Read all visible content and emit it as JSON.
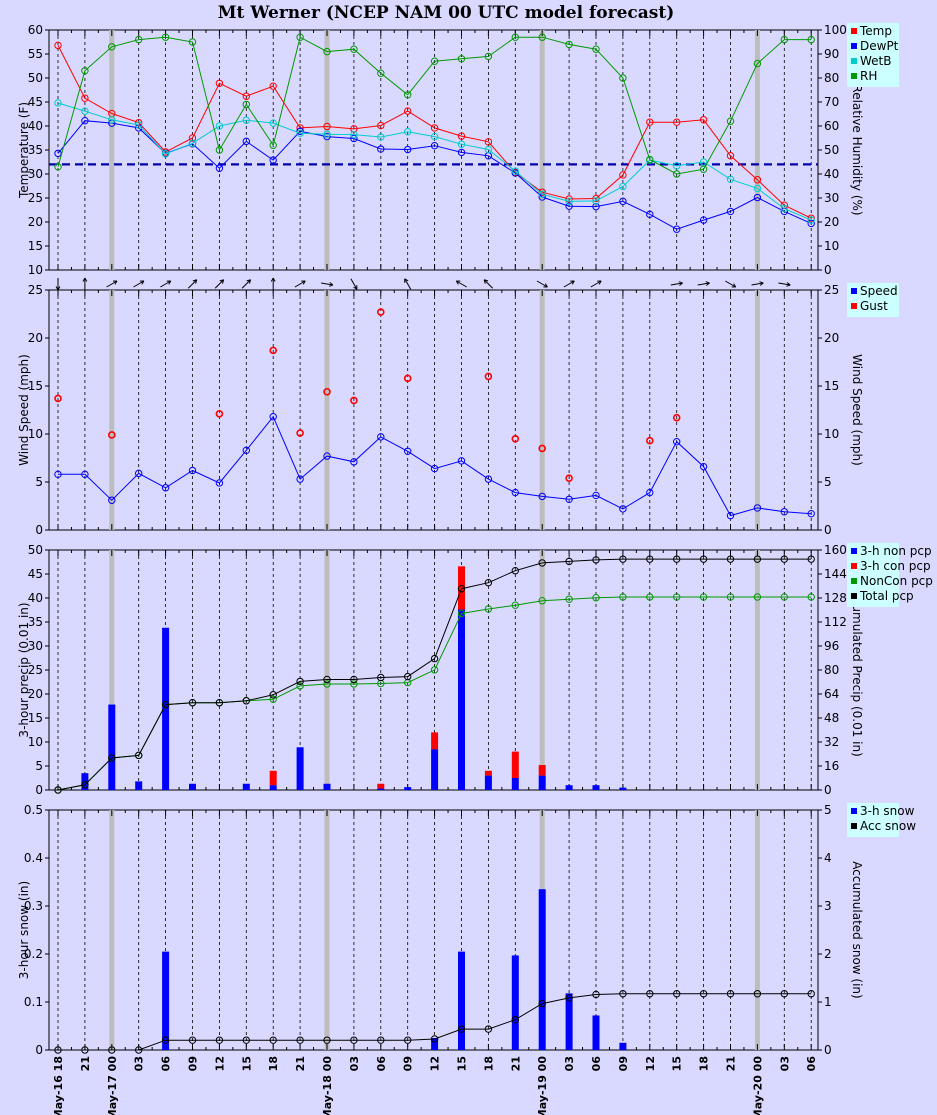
{
  "title": "Mt Werner (NCEP NAM 00 UTC model forecast)",
  "x_tick_labels": [
    "May-16 18",
    "21",
    "May-17 00",
    "03",
    "06",
    "09",
    "12",
    "15",
    "18",
    "21",
    "May-18 00",
    "03",
    "06",
    "09",
    "12",
    "15",
    "18",
    "21",
    "May-19 00",
    "03",
    "06",
    "09",
    "12",
    "15",
    "18",
    "21",
    "May-20 00",
    "03",
    "06"
  ],
  "colors": {
    "temp": "#ff0000",
    "dewpt": "#0000ff",
    "wetb": "#00cccc",
    "rh": "#009900",
    "gust": "#ff0000",
    "total": "#000000",
    "freezing": "#0000aa",
    "bg": "#d9d9ff",
    "grid_day": "#bdbdbd"
  },
  "chart_data": [
    {
      "type": "line",
      "panel": "temperature",
      "ylabel": "Temperature (F)",
      "y2label": "Relative Humidity (%)",
      "ylim": [
        10,
        60
      ],
      "y2lim": [
        0,
        100
      ],
      "yticks": [
        10,
        15,
        20,
        25,
        30,
        35,
        40,
        45,
        50,
        55,
        60
      ],
      "y2ticks": [
        0,
        10,
        20,
        30,
        40,
        50,
        60,
        70,
        80,
        90,
        100
      ],
      "freezing_line": 32,
      "legend": [
        "Temp",
        "DewPt",
        "WetB",
        "RH"
      ],
      "legend_position": "right",
      "series": [
        {
          "name": "Temp",
          "axis": "left",
          "values": [
            56.8,
            45.8,
            42.6,
            40.7,
            34.6,
            37.5,
            48.9,
            46.2,
            48.3,
            39.6,
            39.9,
            39.4,
            40.1,
            43.1,
            39.6,
            37.9,
            36.7,
            30.3,
            26.2,
            24.8,
            24.9,
            29.8,
            40.8,
            40.8,
            41.3,
            33.8,
            28.8,
            23.5,
            20.8
          ]
        },
        {
          "name": "DewPt",
          "axis": "left",
          "values": [
            34.3,
            41.1,
            40.6,
            39.6,
            34.3,
            36.3,
            31.2,
            36.8,
            32.9,
            38.9,
            37.8,
            37.4,
            35.2,
            35.1,
            35.9,
            34.5,
            33.8,
            30.2,
            25.2,
            23.3,
            23.2,
            24.3,
            21.6,
            18.5,
            20.4,
            22.2,
            25.1,
            22.2,
            19.7
          ]
        },
        {
          "name": "WetB",
          "axis": "left",
          "values": [
            44.8,
            43.1,
            41.3,
            40.2,
            34.2,
            36.4,
            40.0,
            41.2,
            40.6,
            38.5,
            38.3,
            38.2,
            37.7,
            38.8,
            37.8,
            36.2,
            35.1,
            30.6,
            25.8,
            24.3,
            24.4,
            27.4,
            32.9,
            31.7,
            32.5,
            28.9,
            27.0,
            22.8,
            20.4
          ]
        },
        {
          "name": "RH",
          "axis": "right",
          "values": [
            43,
            83,
            93,
            96,
            97,
            95,
            50,
            69,
            52,
            97,
            91,
            92,
            82,
            73,
            87,
            88,
            89,
            97,
            97,
            94,
            92,
            80,
            46,
            40,
            42,
            62,
            86,
            96,
            96
          ]
        }
      ]
    },
    {
      "type": "line",
      "panel": "wind",
      "ylabel": "Wind Speed (mph)",
      "y2label": "Wind Speed (mph)",
      "ylim": [
        0,
        25
      ],
      "yticks": [
        0,
        5,
        10,
        15,
        20,
        25
      ],
      "legend": [
        "Speed",
        "Gust"
      ],
      "legend_position": "right",
      "series": [
        {
          "name": "Speed",
          "values": [
            5.8,
            5.8,
            3.1,
            5.9,
            4.4,
            6.2,
            4.9,
            8.3,
            11.8,
            5.3,
            7.7,
            7.1,
            9.7,
            8.2,
            6.4,
            7.2,
            5.3,
            3.9,
            3.5,
            3.2,
            3.6,
            2.2,
            3.9,
            9.2,
            6.6,
            1.5,
            2.3,
            1.9,
            1.7
          ]
        },
        {
          "name": "Gust",
          "values": [
            13.7,
            null,
            9.9,
            null,
            null,
            null,
            12.1,
            null,
            18.7,
            10.1,
            14.4,
            13.5,
            22.7,
            15.8,
            null,
            null,
            16.0,
            9.5,
            8.5,
            5.4,
            null,
            null,
            9.3,
            11.7,
            null,
            null,
            null,
            null,
            null
          ]
        }
      ],
      "wind_direction_deg": [
        180,
        0,
        60,
        60,
        60,
        45,
        45,
        45,
        0,
        60,
        100,
        150,
        null,
        330,
        null,
        300,
        315,
        null,
        120,
        60,
        60,
        null,
        null,
        80,
        80,
        120,
        80,
        100,
        null
      ]
    },
    {
      "type": "bar",
      "panel": "precip",
      "ylabel": "3-hour precip (0.01 in)",
      "y2label": "Accumulated Precip (0.01 in)",
      "ylim": [
        0,
        50
      ],
      "y2lim": [
        0,
        160
      ],
      "yticks": [
        0,
        5,
        10,
        15,
        20,
        25,
        30,
        35,
        40,
        45,
        50
      ],
      "y2ticks": [
        0,
        16,
        32,
        48,
        64,
        80,
        96,
        112,
        128,
        144,
        160
      ],
      "legend": [
        "3-h non pcp",
        "3-h con pcp",
        "NonCon pcp",
        "Total pcp"
      ],
      "legend_position": "right",
      "series": [
        {
          "name": "3-h non pcp",
          "values": [
            0,
            3.5,
            17.8,
            1.8,
            33.8,
            1.3,
            0,
            1.3,
            1.0,
            8.9,
            1.3,
            0,
            0.3,
            0.6,
            8.5,
            37.6,
            3.0,
            2.5,
            3.0,
            1.0,
            1.0,
            0.5,
            0,
            0,
            0,
            0,
            0,
            0,
            0
          ]
        },
        {
          "name": "3-h con pcp",
          "values": [
            0,
            0,
            0,
            0,
            0,
            0,
            0,
            0,
            3.0,
            0,
            0,
            0,
            1.0,
            0,
            3.5,
            9.0,
            1.0,
            5.5,
            2.2,
            0,
            0,
            0,
            0,
            0,
            0,
            0,
            0,
            0,
            0
          ]
        },
        {
          "name": "NonCon pcp",
          "values": [
            0,
            3.5,
            21.3,
            23.1,
            56.9,
            58.2,
            58.2,
            59.5,
            60.5,
            69.4,
            70.7,
            70.7,
            71.0,
            71.6,
            80.1,
            117.7,
            120.7,
            123.2,
            126.2,
            127.2,
            128.2,
            128.7,
            128.7,
            128.7,
            128.7,
            128.7,
            128.7,
            128.7,
            128.7
          ]
        },
        {
          "name": "Total pcp",
          "values": [
            0,
            3.5,
            21.3,
            23.1,
            56.9,
            58.2,
            58.2,
            59.5,
            63.5,
            72.4,
            73.7,
            73.7,
            75.0,
            75.6,
            87.6,
            134.2,
            138.2,
            146.2,
            151.4,
            152.4,
            153.4,
            153.9,
            153.9,
            153.9,
            153.9,
            153.9,
            153.9,
            153.9,
            153.9
          ]
        }
      ]
    },
    {
      "type": "bar",
      "panel": "snow",
      "ylabel": "3-hour snow (in)",
      "y2label": "Accumulated snow (in)",
      "ylim": [
        0,
        0.5
      ],
      "y2lim": [
        0,
        5
      ],
      "yticks": [
        "0",
        "0.1",
        "0.2",
        "0.3",
        "0.4",
        "0.5"
      ],
      "y2ticks": [
        "0",
        "1",
        "2",
        "3",
        "4",
        "5"
      ],
      "legend": [
        "3-h snow",
        "Acc snow"
      ],
      "legend_position": "right",
      "series": [
        {
          "name": "3-h snow",
          "values": [
            0,
            0,
            0,
            0,
            0.205,
            0,
            0,
            0,
            0,
            0,
            0,
            0,
            0,
            0,
            0.025,
            0.205,
            0,
            0.197,
            0.335,
            0.118,
            0.072,
            0.015,
            0,
            0,
            0,
            0,
            0,
            0,
            0
          ]
        },
        {
          "name": "Acc snow",
          "values": [
            0,
            0,
            0,
            0,
            0.205,
            0.205,
            0.205,
            0.205,
            0.205,
            0.205,
            0.205,
            0.205,
            0.205,
            0.205,
            0.23,
            0.435,
            0.435,
            0.632,
            0.967,
            1.085,
            1.157,
            1.172,
            1.172,
            1.172,
            1.172,
            1.172,
            1.172,
            1.172,
            1.172
          ]
        }
      ]
    }
  ]
}
